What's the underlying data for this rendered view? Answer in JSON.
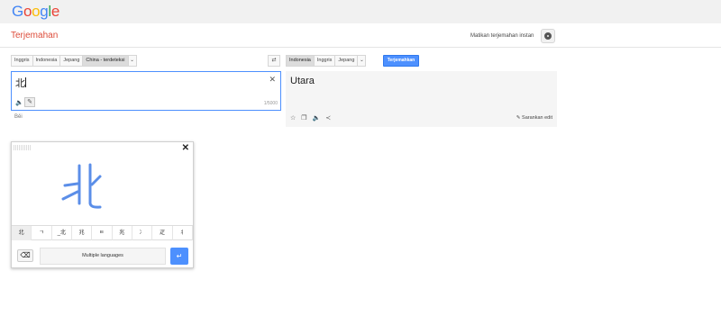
{
  "header": {
    "logo_text": "Google",
    "logo_colors": [
      "#4285f4",
      "#ea4335",
      "#fbbc05",
      "#4285f4",
      "#34a853",
      "#ea4335"
    ],
    "product_title": "Terjemahan",
    "instant_toggle": "Matikan terjemahan instan",
    "settings_icon": "gear-icon"
  },
  "source": {
    "languages": [
      {
        "label": "Inggris",
        "selected": false
      },
      {
        "label": "Indonesia",
        "selected": false
      },
      {
        "label": "Jepang",
        "selected": false
      },
      {
        "label": "China - terdeteksi",
        "selected": true
      }
    ],
    "dropdown_icon": "chevron-down-icon",
    "text": "北",
    "char_count": "1/5000",
    "romanization": "Běi",
    "clear_icon": "close-icon",
    "audio_icon": "speaker-icon",
    "pencil_icon": "pencil-icon"
  },
  "swap_icon": "swap-icon",
  "target": {
    "languages": [
      {
        "label": "Indonesia",
        "selected": true
      },
      {
        "label": "Inggris",
        "selected": false
      },
      {
        "label": "Jepang",
        "selected": false
      }
    ],
    "dropdown_icon": "chevron-down-icon",
    "translate_button": "Terjemahkan",
    "text": "Utara",
    "tools": [
      "star-icon",
      "copy-icon",
      "speaker-icon",
      "share-icon"
    ],
    "suggest_edit": "Sarankan edit",
    "suggest_edit_icon": "pencil-icon"
  },
  "handwriting": {
    "handle_icon": "drag-handle-icon",
    "close_icon": "close-icon",
    "ink_color": "#5b8ee8",
    "candidates": [
      "北",
      "ㄱ",
      "_北",
      "兆",
      "ㅌ",
      "兆",
      "冫",
      "疋",
      "丬"
    ],
    "backspace_icon": "backspace-icon",
    "language_button": "Multiple languages",
    "enter_icon": "enter-icon"
  }
}
